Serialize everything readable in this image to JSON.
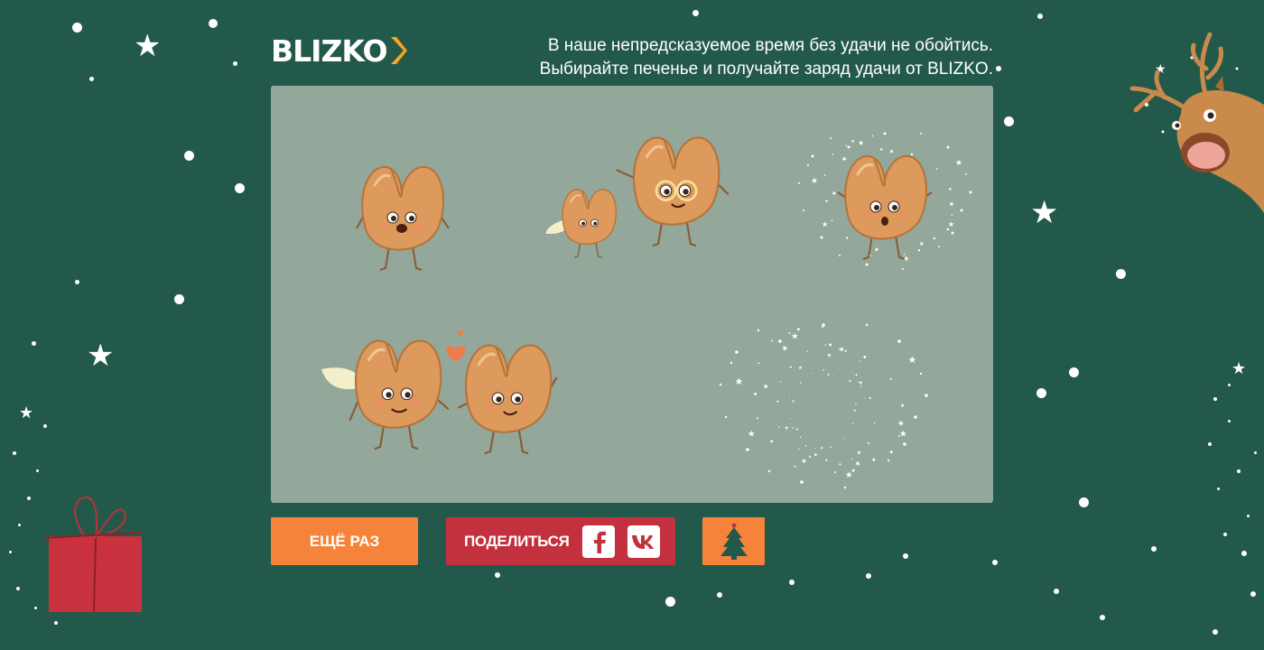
{
  "brand": {
    "logo_text": "BLIZKO",
    "accent_color": "#f5a623",
    "background_color": "#23594a"
  },
  "tagline": {
    "line1": "В наше непредсказуемое время без удачи не обойтись.",
    "line2": "Выбирайте печенье и получайте заряд удачи от BLIZKO."
  },
  "stage": {
    "background_color": "#93a79b",
    "cookies": [
      {
        "name": "cookie-single-smiling",
        "icon": "fortune-cookie-icon"
      },
      {
        "name": "cookie-pair-glasses",
        "icon": "fortune-cookie-icon"
      },
      {
        "name": "cookie-sparkle-surprised",
        "icon": "fortune-cookie-icon"
      },
      {
        "name": "cookie-pair-love",
        "icon": "fortune-cookie-icon"
      },
      {
        "name": "cookie-sparkle-vanished",
        "icon": "sparkles-icon"
      }
    ]
  },
  "buttons": {
    "again_label": "ЕЩЁ РАЗ",
    "share_label": "ПОДЕЛИТЬСЯ",
    "facebook_icon": "facebook-icon",
    "vk_icon": "vk-icon",
    "tree_icon": "christmas-tree-icon"
  },
  "colors": {
    "orange_button": "#f5843a",
    "red_button": "#c4313e",
    "cookie": "#dd9a5c"
  }
}
